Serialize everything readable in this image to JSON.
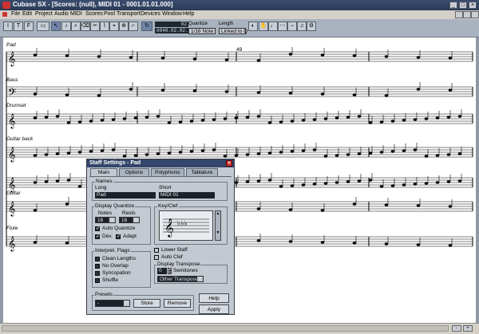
{
  "window": {
    "title": "Cubase SX - [Scores: (null), MIDI 01 - 0001.01.01.000]"
  },
  "menu": [
    "File",
    "Edit",
    "Project",
    "Audio",
    "MIDI",
    "Scores",
    "Pool",
    "Transport",
    "Devices",
    "Window",
    "Help"
  ],
  "toolbar": {
    "text_buttons": [
      "I",
      "T",
      "F"
    ],
    "position_value": "82",
    "position_time": "0048.02.02.000",
    "quantize_label": "Quantize",
    "quantize_value": "1/16 Note",
    "length_label": "Length",
    "length_value": "Linked to Q"
  },
  "score": {
    "staves": [
      "Pad",
      "Bass",
      "Drumset",
      "Guitar back",
      "",
      "Guitar",
      "Flute"
    ],
    "bar_number": "49"
  },
  "dialog": {
    "title": "Staff Settings - Pad",
    "tabs": [
      "Main",
      "Options",
      "Polyphonic",
      "Tablature"
    ],
    "active_tab": "Main",
    "names": {
      "group": "Names",
      "long_label": "Long",
      "long_value": "Pad",
      "short_label": "Short",
      "short_value": "MIDI 01"
    },
    "display_quantize": {
      "group": "Display Quantize",
      "notes_label": "Notes",
      "notes_value": "16",
      "rests_label": "Rests",
      "rests_value": "16",
      "auto_quantize": "Auto Quantize",
      "dev": "Dev.",
      "adapt": "Adapt"
    },
    "key_clef": {
      "group": "Key/Clef",
      "lower_staff": "Lower Staff",
      "auto_clef": "Auto Clef"
    },
    "interpret_flags": {
      "group": "Interpret. Flags",
      "clean_lengths": "Clean Lengths",
      "no_overlap": "No Overlap",
      "syncopation": "Syncopation",
      "shuffle": "Shuffle"
    },
    "display_transpose": {
      "group": "Display Transpose",
      "semitones_value": "0",
      "semitones_label": "Semitones",
      "transpose_value": "Other Transpose"
    },
    "presets": {
      "group": "Presets",
      "value": "-",
      "store": "Store",
      "remove": "Remove"
    },
    "help": "Help",
    "apply": "Apply"
  },
  "colors": {
    "titlebar": "#34466a",
    "dialog_bg": "#c3c9d1",
    "toolbar_bg": "#a9b3bf"
  }
}
